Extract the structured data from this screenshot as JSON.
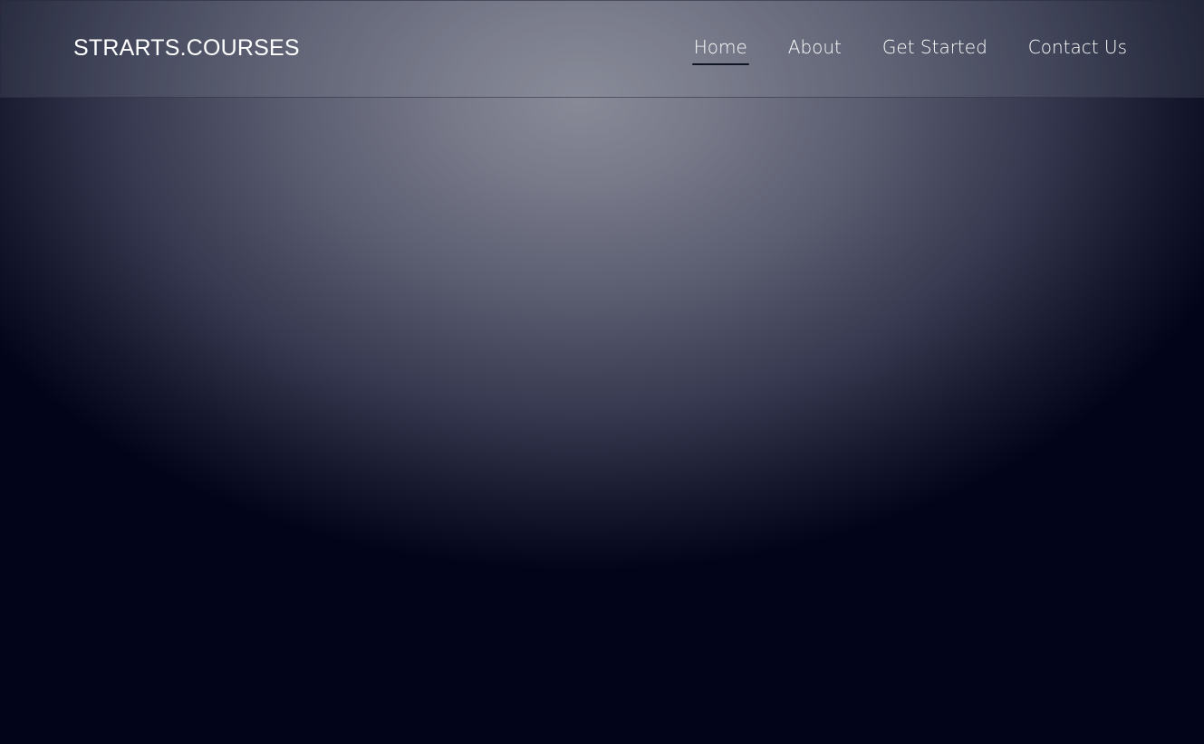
{
  "header": {
    "brand": "STRARTS.COURSES",
    "nav": [
      {
        "label": "Home",
        "active": true
      },
      {
        "label": "About",
        "active": false
      },
      {
        "label": "Get Started",
        "active": false
      },
      {
        "label": "Contact Us",
        "active": false
      }
    ]
  },
  "colors": {
    "page_background": "#02051a",
    "glow": "#888a98",
    "text": "#ffffff",
    "active_underline": "#101524"
  }
}
